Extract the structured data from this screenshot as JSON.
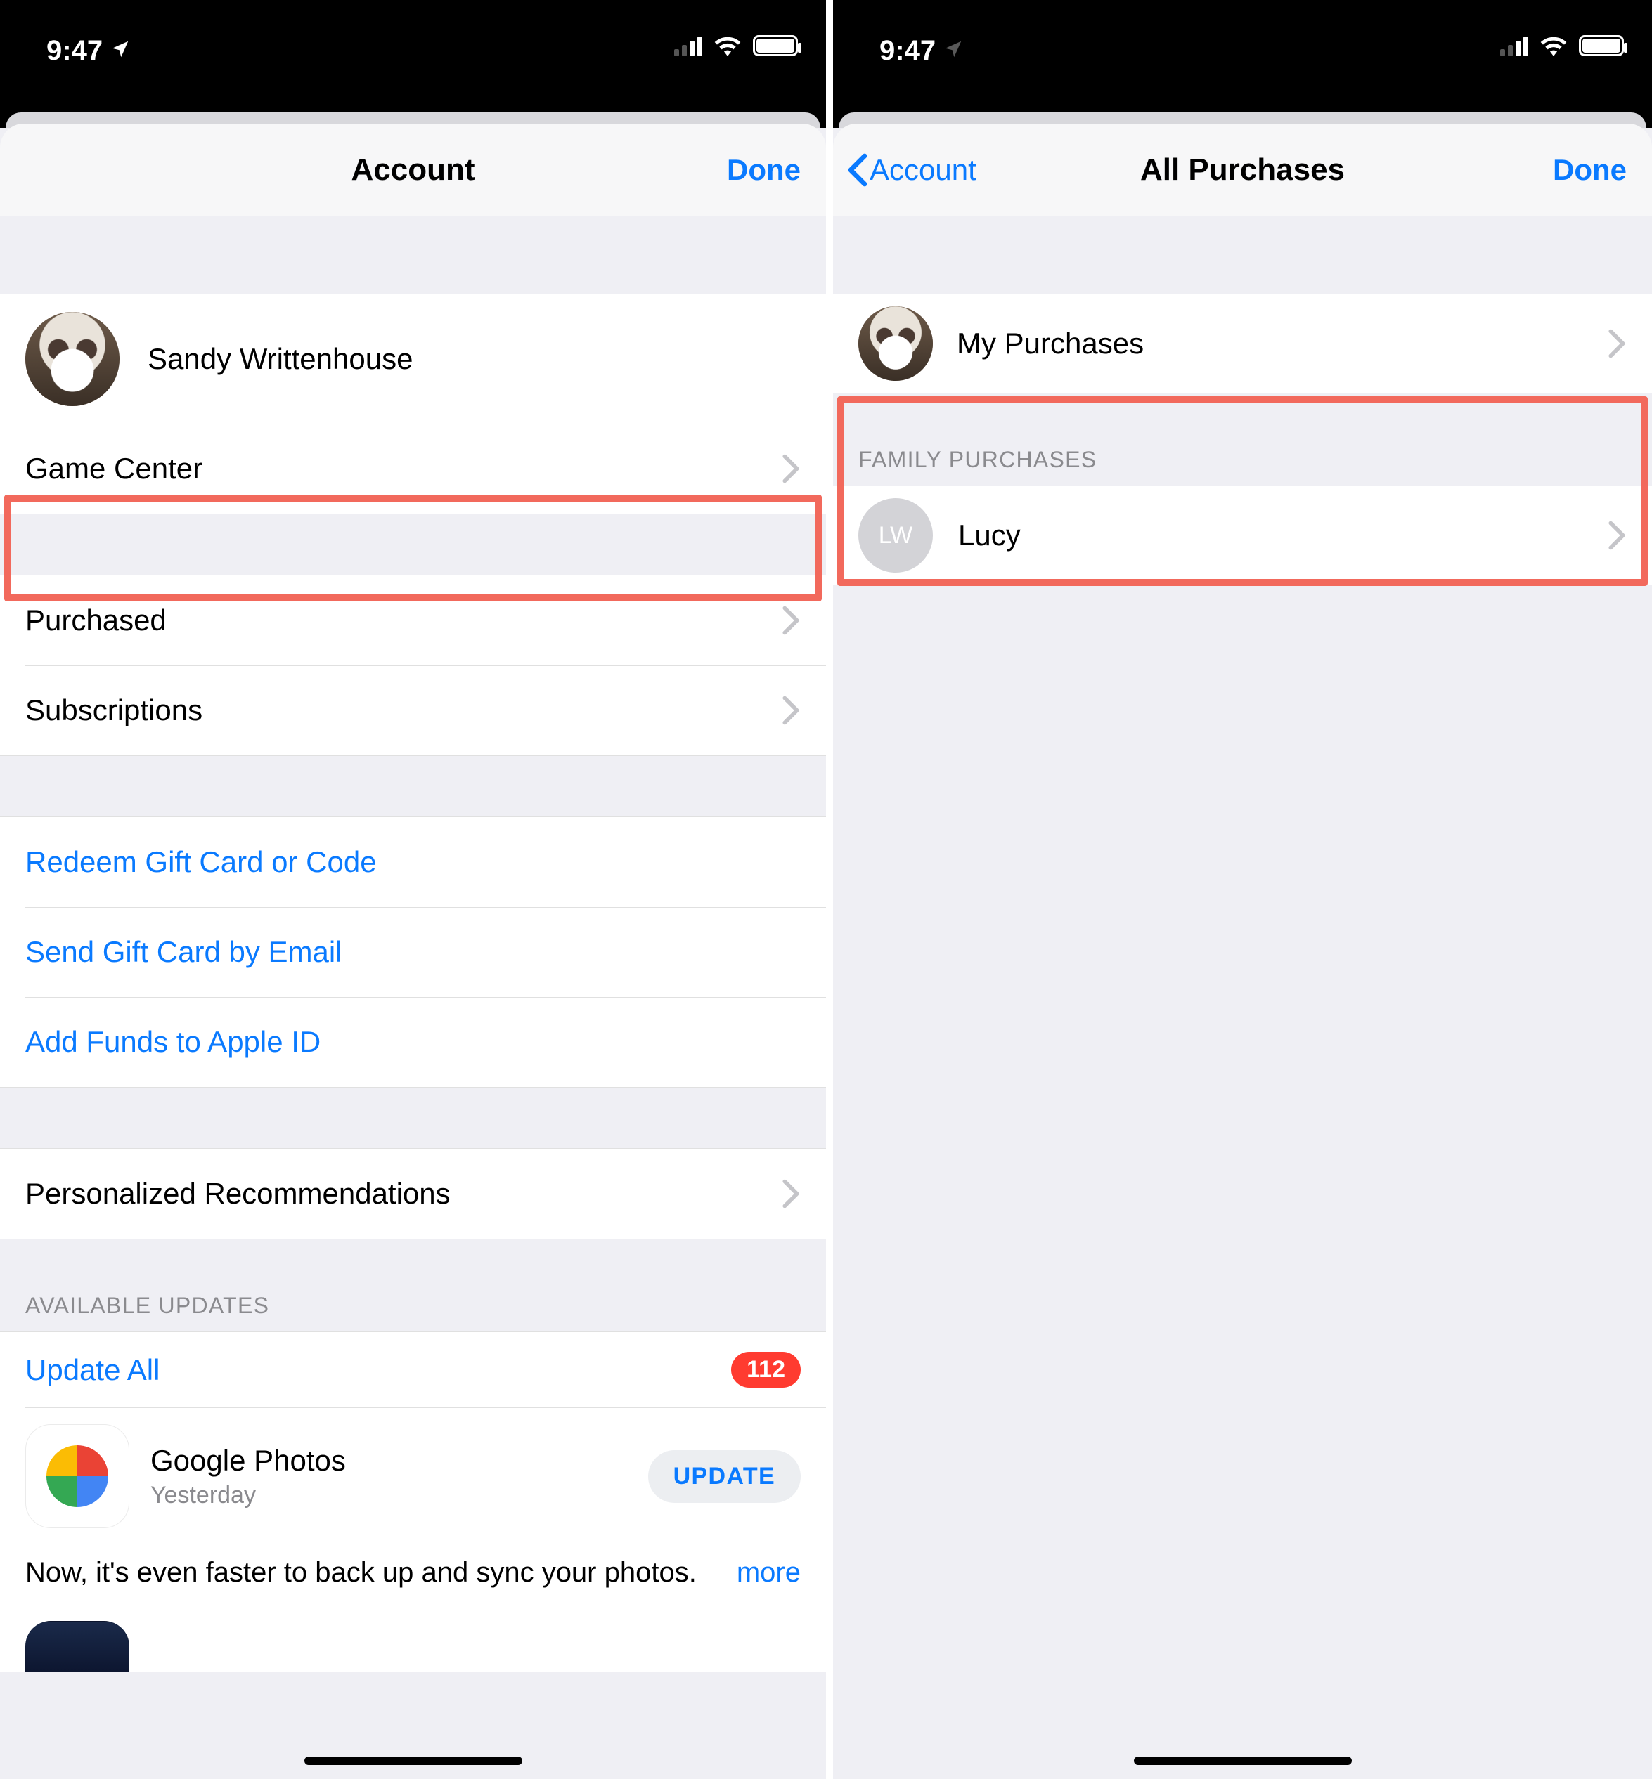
{
  "left": {
    "status": {
      "time": "9:47"
    },
    "nav": {
      "title": "Account",
      "done": "Done"
    },
    "profile_name": "Sandy Writtenhouse",
    "rows": {
      "game_center": "Game Center",
      "purchased": "Purchased",
      "subscriptions": "Subscriptions",
      "redeem": "Redeem Gift Card or Code",
      "send_gift": "Send Gift Card by Email",
      "add_funds": "Add Funds to Apple ID",
      "personalized": "Personalized Recommendations"
    },
    "updates": {
      "header": "AVAILABLE UPDATES",
      "update_all": "Update All",
      "badge": "112",
      "app": {
        "name": "Google Photos",
        "date": "Yesterday",
        "button": "UPDATE",
        "desc": "Now, it's even faster to back up and sync your photos.",
        "more": "more"
      }
    }
  },
  "right": {
    "status": {
      "time": "9:47"
    },
    "nav": {
      "back": "Account",
      "title": "All Purchases",
      "done": "Done"
    },
    "my_purchases": "My Purchases",
    "family_header": "FAMILY PURCHASES",
    "family_member": {
      "initials": "LW",
      "name": "Lucy"
    }
  }
}
